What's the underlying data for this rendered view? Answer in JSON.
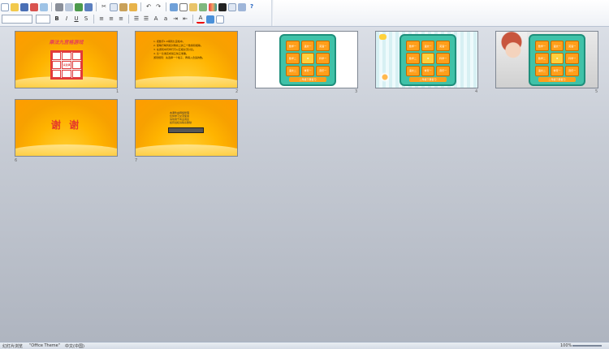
{
  "toolbar": {
    "row1_icons": [
      "new-icon",
      "open-icon",
      "save-icon",
      "permission-icon",
      "email-icon",
      "print-icon",
      "print-preview-icon",
      "spelling-icon",
      "research-icon",
      "cut-icon",
      "copy-icon",
      "paste-icon",
      "format-painter-icon",
      "undo-icon",
      "redo-icon",
      "hyperlink-icon",
      "table-icon",
      "chart-icon",
      "insert-icon",
      "color-icon",
      "grayscale-icon",
      "expand-icon",
      "zoom-icon",
      "help-icon"
    ],
    "row2_icons": [
      "bold-icon",
      "italic-icon",
      "underline-icon",
      "shadow-icon",
      "align-left-icon",
      "center-icon",
      "align-right-icon",
      "bullets-icon",
      "numbering-icon",
      "increase-font-icon",
      "decrease-font-icon",
      "indent-icon",
      "outdent-icon",
      "font-color-icon",
      "design-icon",
      "new-slide-icon"
    ]
  },
  "slides": [
    {
      "number": "1",
      "title": "乘法九宫格游戏",
      "cells": [
        "",
        "",
        "",
        "",
        "请选择",
        "",
        "",
        "",
        ""
      ]
    },
    {
      "number": "2",
      "lines": [
        "1. 把数字1-9填到九宫格中。",
        "2. 使每行每列和对角线上的三个数乘积相等。",
        "3. 在游戏中同学们可以互相交流讨论。",
        "4. 比一比谁完成得又快又准确。",
        "游戏规则：先选择一个格子，再填入合适的数。"
      ]
    },
    {
      "number": "3",
      "cells": [
        "数学一",
        "语文一",
        "英语一",
        "数学二",
        "",
        "科学一",
        "语文二",
        "体育一",
        "音乐一"
      ],
      "footer": "二年级下册复习"
    },
    {
      "number": "4",
      "cells": [
        "数学一",
        "语文一",
        "英语一",
        "数学二",
        "",
        "科学一",
        "语文二",
        "体育一",
        "音乐一"
      ],
      "footer": "二年级下册复习"
    },
    {
      "number": "5",
      "cells": [
        "数学一",
        "语文一",
        "英语一",
        "数学二",
        "",
        "科学一",
        "语文二",
        "体育一",
        "音乐一"
      ],
      "footer": "二年级下册复习"
    },
    {
      "number": "6",
      "text": "谢 谢"
    },
    {
      "number": "7",
      "lines": [
        "本课件由网络整理",
        "仅供学习交流使用",
        "请勿用于商业用途",
        "如有侵权请联系删除"
      ],
      "button": "Office Theme"
    }
  ],
  "statusbar": {
    "view": "幻灯片浏览",
    "theme": "\"Office Theme\"",
    "language": "中文(中国)",
    "zoom": "100%"
  },
  "colors": {
    "accent_orange": "#ffb400",
    "teal": "#3fc2a8",
    "title_red": "#e53b5a"
  }
}
